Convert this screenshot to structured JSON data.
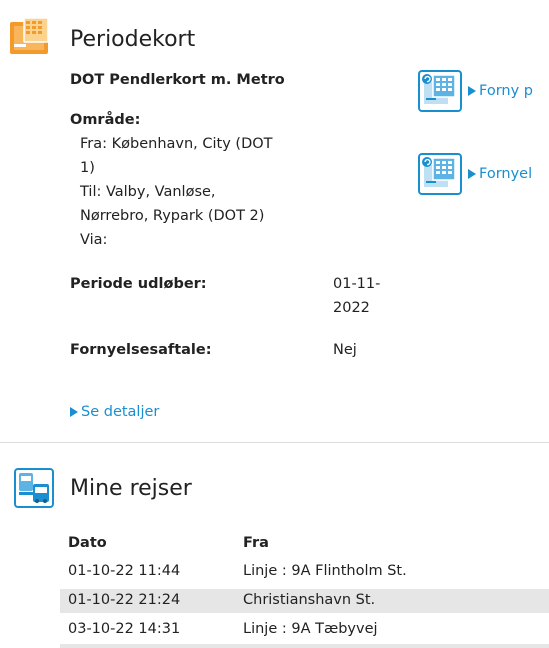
{
  "periodekort": {
    "title": "Periodekort",
    "card_name": "DOT Pendlerkort m. Metro",
    "area_label": "Område:",
    "from_line1": "Fra: København, City (DOT",
    "from_line2": "1)",
    "to_line1": "Til: Valby, Vanløse,",
    "to_line2": "Nørrebro, Rypark (DOT 2)",
    "via": "Via:",
    "period_label": "Periode udløber:",
    "period_value_line1": "01-11-",
    "period_value_line2": "2022",
    "renewal_label": "Fornyelsesaftale:",
    "renewal_value": "Nej",
    "details_link": "Se detaljer",
    "actions": [
      {
        "label": "Forny p"
      },
      {
        "label": "Fornyel"
      }
    ]
  },
  "rejser": {
    "title": "Mine rejser",
    "columns": [
      "Dato",
      "Fra"
    ],
    "rows": [
      {
        "date": "01-10-22  11:44",
        "from": "Linje : 9A Flintholm St."
      },
      {
        "date": "01-10-22  21:24",
        "from": "Christianshavn St."
      },
      {
        "date": "03-10-22  14:31",
        "from": "Linje : 9A Tæbyvej"
      }
    ]
  },
  "colors": {
    "accent_orange": "#f39a2b",
    "link_blue": "#1a8fd0",
    "row_shade": "#e6e6e6"
  },
  "icons": {
    "periodekort": "card-icon",
    "renew": "card-renew-icon",
    "rejser": "train-bus-icon"
  }
}
